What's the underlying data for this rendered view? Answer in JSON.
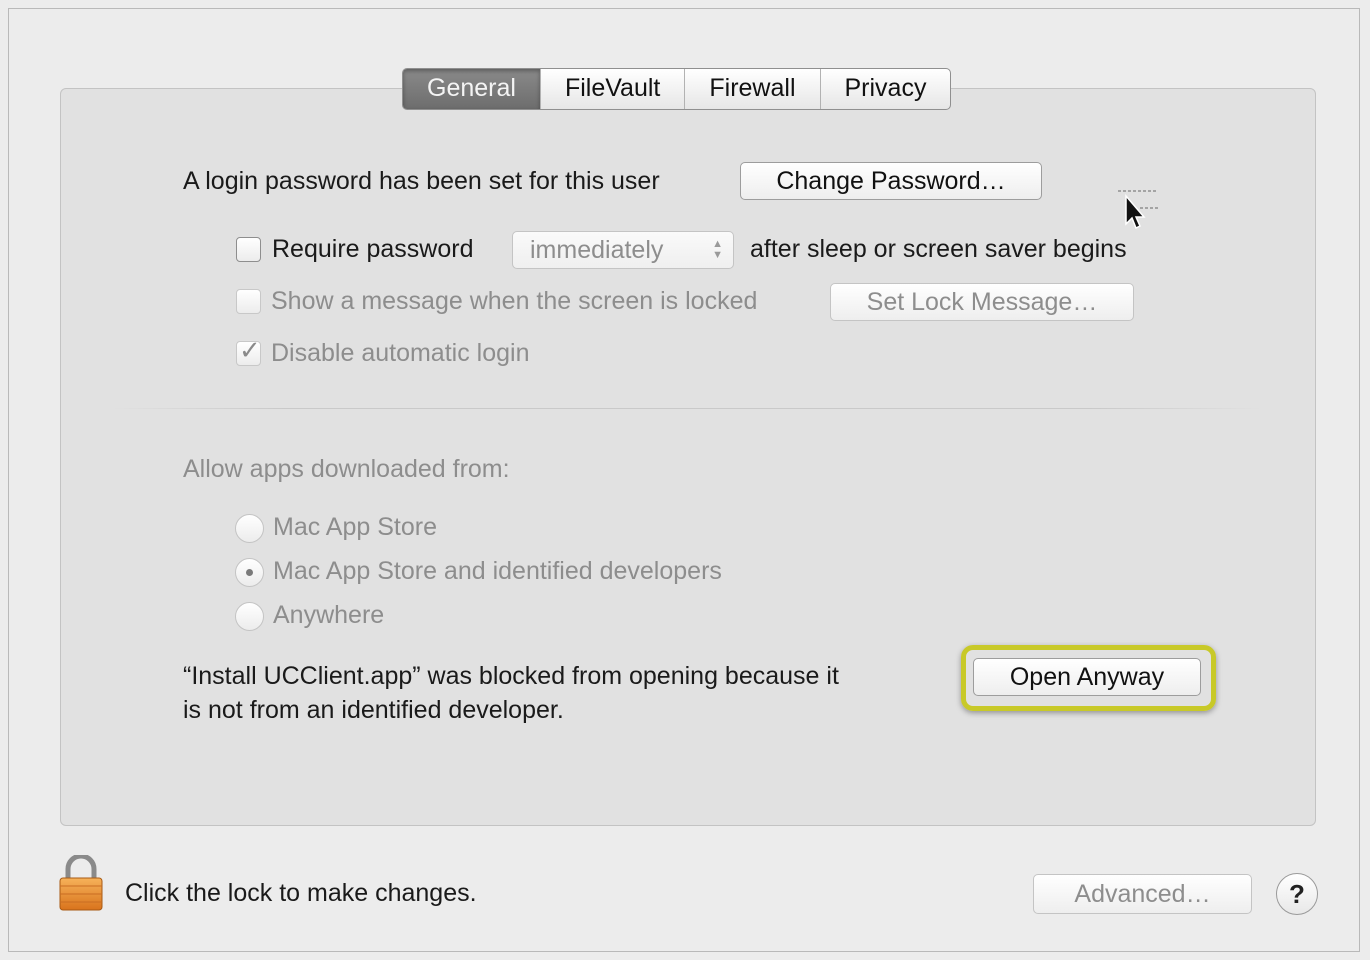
{
  "tabs": [
    {
      "label": "General",
      "selected": true
    },
    {
      "label": "FileVault",
      "selected": false
    },
    {
      "label": "Firewall",
      "selected": false
    },
    {
      "label": "Privacy",
      "selected": false
    }
  ],
  "password": {
    "status_text": "A login password has been set for this user",
    "change_button": "Change Password…"
  },
  "require_password": {
    "label": "Require password",
    "checked": false,
    "popup_value": "immediately",
    "suffix": "after sleep or screen saver begins"
  },
  "lock_message": {
    "label": "Show a message when the screen is locked",
    "checked": false,
    "button": "Set Lock Message…"
  },
  "auto_login": {
    "label": "Disable automatic login",
    "checked": true
  },
  "gatekeeper": {
    "heading": "Allow apps downloaded from:",
    "options": [
      {
        "label": "Mac App Store",
        "selected": false
      },
      {
        "label": "Mac App Store and identified developers",
        "selected": true
      },
      {
        "label": "Anywhere",
        "selected": false
      }
    ]
  },
  "blocked": {
    "line1": "“Install UCClient.app” was blocked from opening because it",
    "line2": "is not from an identified developer.",
    "button": "Open Anyway",
    "highlight_color": "#c8c928"
  },
  "footer": {
    "lock_text": "Click the lock to make changes.",
    "advanced_button": "Advanced…",
    "help_label": "?"
  },
  "icons": {
    "lock": "padlock-icon",
    "help": "question-icon",
    "cursor": "arrow-cursor-icon",
    "popup_arrows": "up-down-chevron-icon"
  }
}
